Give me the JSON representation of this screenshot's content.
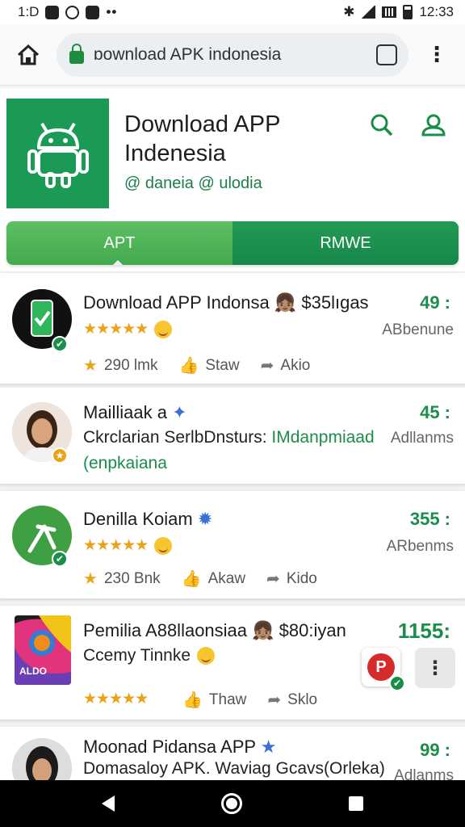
{
  "status": {
    "time_left": "1:D",
    "time_right": "12:33",
    "more": "••"
  },
  "browser": {
    "url": "ɒownload APK indonesia",
    "tabs_count": ""
  },
  "site": {
    "title": "Download APP Indenesia",
    "subtitle": "@ daneia @ ulodia",
    "logo_color": "#1b9a55",
    "accent": "#1a8d49"
  },
  "tabs": [
    {
      "label": "APT"
    },
    {
      "label": "RMWE"
    }
  ],
  "apps": [
    {
      "name": "Download APP Indonsa 👧🏽 $35lıgas",
      "stars": "★★★★★",
      "rank": "49 :",
      "meta": "ABbenune",
      "actions": {
        "rating": "290 lmk",
        "share": "Staw",
        "forward": "Akio"
      }
    },
    {
      "name": "Mailliaak a",
      "line2": "Ckrclarian SerlbDnsturs: ",
      "line2_green": "IMdanpmiaad",
      "line3": "(enpkaiana",
      "rank": "45 :",
      "meta": "Adllanms"
    },
    {
      "name": "Denilla Koiam",
      "stars": "★★★★★",
      "rank": "355 :",
      "meta": "ARbenms",
      "actions": {
        "rating": "230 Bnk",
        "share": "Akaw",
        "forward": "Kido"
      }
    },
    {
      "name": "Pemilia A88llaonsiaa 👧🏽 $80:iyan",
      "line2": "Ccemy Tinnke",
      "stars": "★★★★★",
      "rank": "1155:",
      "icon_label": "ALDO",
      "actions": {
        "share": "Thaw",
        "forward": "Sklo"
      }
    },
    {
      "name": "Moonad Pidansa APP",
      "line2": "Domasaloy APK. Waviag Gcavs(Orleka)",
      "rank": "99 :",
      "meta": "Adlanms"
    }
  ]
}
